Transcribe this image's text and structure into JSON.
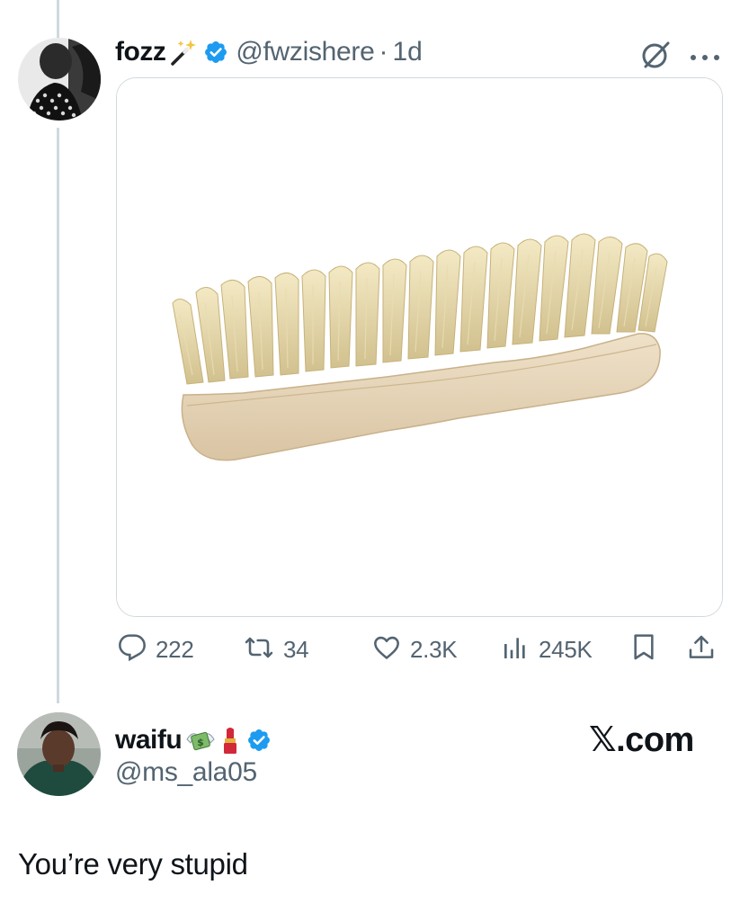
{
  "post": {
    "author_name": "fozz",
    "handle": "@fwzishere",
    "separator": "·",
    "timestamp": "1d",
    "media_alt": "wooden scrub brush",
    "stats": {
      "replies": "222",
      "reposts": "34",
      "likes": "2.3K",
      "views": "245K"
    }
  },
  "reply": {
    "author_name": "waifu",
    "handle": "@ms_ala05",
    "text": "You’re very stupid"
  },
  "watermark": {
    "logo": "𝕏",
    "suffix": ".com"
  },
  "icons": {
    "post_name_emoji": "magic-wand-icon",
    "reply_name_emojis": [
      "money-with-wings-icon",
      "lipstick-icon"
    ],
    "verified": "verified-badge-icon",
    "top_right": [
      "grok-icon",
      "more-icon"
    ],
    "actions": [
      "reply-icon",
      "repost-icon",
      "like-icon",
      "views-icon",
      "bookmark-icon",
      "share-icon"
    ]
  },
  "colors": {
    "verified_blue": "#1d9bf0",
    "secondary_text": "#536471",
    "primary_text": "#0f1419",
    "thread_line": "#cfd9de"
  }
}
